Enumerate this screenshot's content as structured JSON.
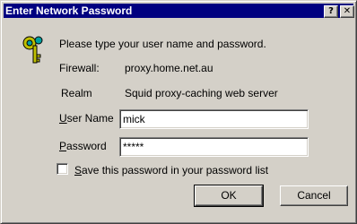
{
  "window": {
    "title": "Enter Network Password",
    "help_glyph": "?",
    "close_glyph": "✕"
  },
  "dialog": {
    "prompt": "Please type your user name and password.",
    "firewall_label": "Firewall:",
    "firewall_value": "proxy.home.net.au",
    "realm_label": "Realm",
    "realm_value": "Squid proxy-caching web server",
    "user_label_hotkey": "U",
    "user_label_rest": "ser Name",
    "user_value": "mick",
    "password_label_hotkey": "P",
    "password_label_rest": "assword",
    "password_value": "*****",
    "save_label_hotkey": "S",
    "save_label_rest": "ave this password in your password list",
    "save_checked": false
  },
  "buttons": {
    "ok": "OK",
    "cancel": "Cancel"
  },
  "icons": {
    "key": "key-icon"
  },
  "colors": {
    "titlebar": "#000080",
    "face": "#d4d0c8"
  }
}
